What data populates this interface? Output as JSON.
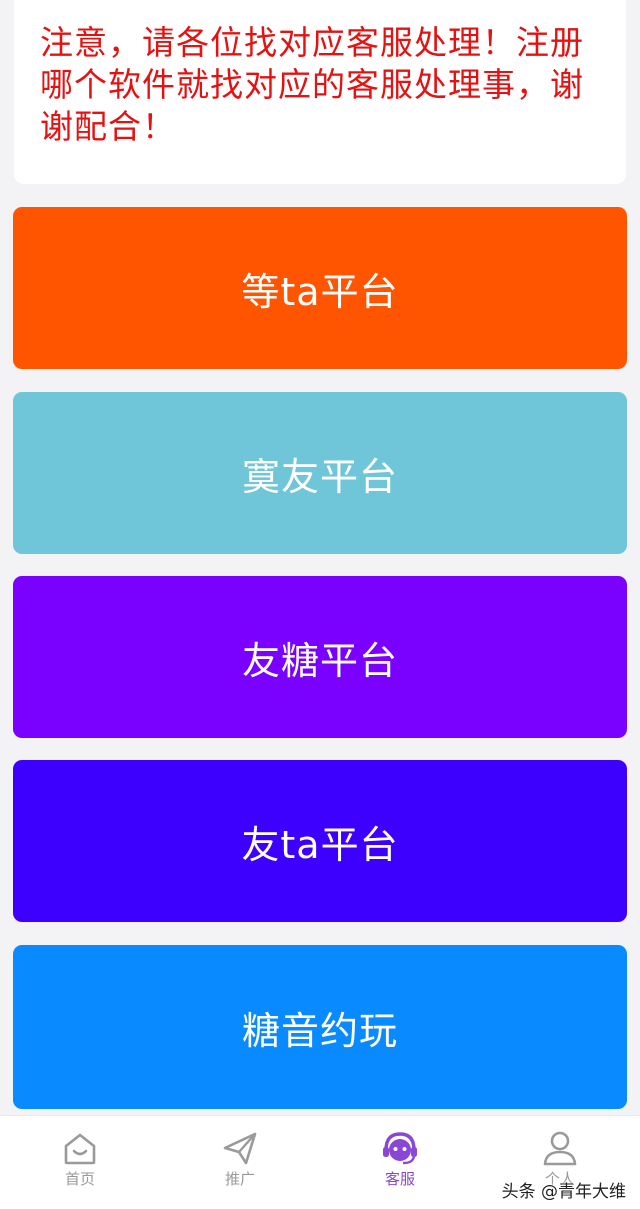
{
  "notice": {
    "text": "注意，请各位找对应客服处理！注册哪个软件就找对应的客服处理事，谢谢配合！"
  },
  "cards": [
    {
      "label": "等ta平台",
      "color": "#ff5500"
    },
    {
      "label": "寞友平台",
      "color": "#6ec6d8"
    },
    {
      "label": "友糖平台",
      "color": "#7a00ff"
    },
    {
      "label": "友ta平台",
      "color": "#3d00ff"
    },
    {
      "label": "糖音约玩",
      "color": "#0a8aff"
    }
  ],
  "tabbar": {
    "items": [
      {
        "label": "首页",
        "icon": "home-icon",
        "active": false
      },
      {
        "label": "推广",
        "icon": "send-icon",
        "active": false
      },
      {
        "label": "客服",
        "icon": "headset-icon",
        "active": true
      },
      {
        "label": "个人",
        "icon": "user-icon",
        "active": false
      }
    ],
    "active_color": "#8a46d4",
    "inactive_color": "#9a9a9a"
  },
  "watermark": {
    "text": "头条 @青年大维"
  }
}
